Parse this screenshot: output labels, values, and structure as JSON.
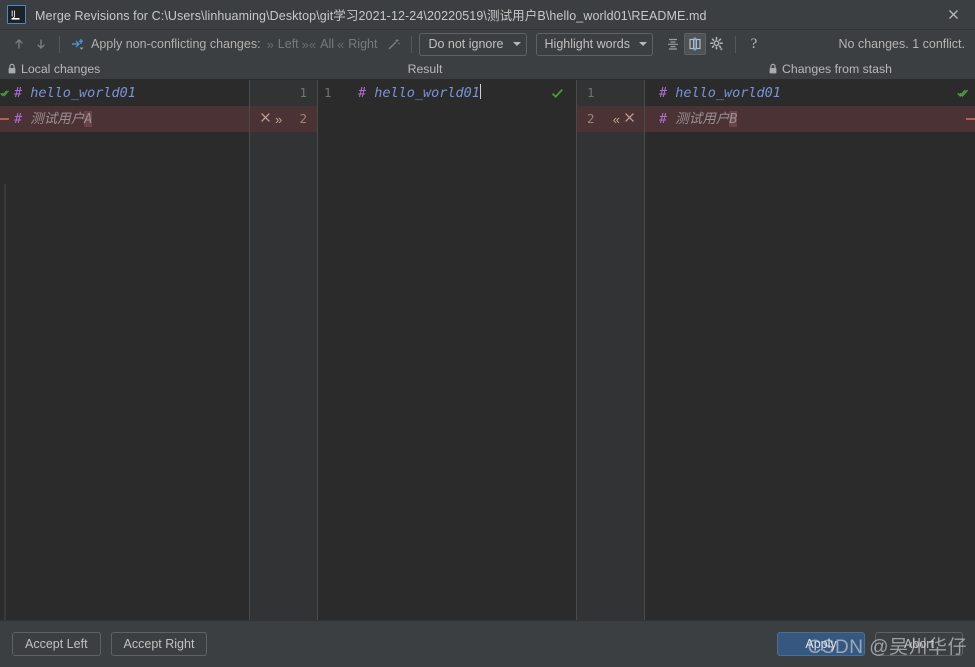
{
  "window": {
    "app_icon": "intellij-idea-icon",
    "title": "Merge Revisions for C:\\Users\\linhuaming\\Desktop\\git学习2021-12-24\\20220519\\测试用户B\\hello_world01\\README.md",
    "close_label": "✕"
  },
  "toolbar": {
    "prev_icon": "arrow-up-icon",
    "next_icon": "arrow-down-icon",
    "resolve_icon": "magic-resolve-icon",
    "apply_label": "Apply non-conflicting changes:",
    "apply_left_label": "Left",
    "apply_all_label": "All",
    "apply_right_label": "Right",
    "wand_icon": "magic-wand-icon",
    "ignore_policy": "Do not ignore",
    "highlight_policy": "Highlight words",
    "collapse_icon": "collapse-unchanged-icon",
    "whitespace_icon": "show-whitespace-icon",
    "settings_icon": "gear-icon",
    "help_icon": "help-icon",
    "status": "No changes. 1 conflict."
  },
  "headers": {
    "left": "Local changes",
    "middle": "Result",
    "right": "Changes from stash",
    "lock_icon": "lock-icon"
  },
  "diff": {
    "left_pane": {
      "name": "Local changes",
      "lines": [
        {
          "marker": "accepted-check",
          "hash": "#",
          "text": " hello_world01",
          "conflict": false
        },
        {
          "marker": "deleted-dash",
          "hash": "#",
          "text": " 测试用户",
          "tail": "A",
          "conflict": true
        }
      ]
    },
    "result_pane": {
      "name": "Result",
      "lines": [
        {
          "hash": "#",
          "text": " hello_world01",
          "status_icon": "check-icon",
          "conflict": false
        },
        {
          "hash": "",
          "text": "",
          "conflict": true
        }
      ]
    },
    "right_pane": {
      "name": "Changes from stash",
      "lines": [
        {
          "marker": "accepted-check",
          "hash": "#",
          "text": " hello_world01",
          "conflict": false
        },
        {
          "marker": "deleted-dash",
          "hash": "#",
          "text": " 测试用户",
          "tail": "B",
          "conflict": true
        }
      ]
    },
    "left_gutter": {
      "numbers": [
        "1",
        "2"
      ],
      "conflict_actions": [
        "revert-icon",
        "accept-right-icon"
      ]
    },
    "result_gutter_left_numbers": [
      "1"
    ],
    "result_gutter_right_numbers": [
      "1"
    ],
    "right_gutter": {
      "numbers": [
        "1",
        "2"
      ],
      "conflict_actions": [
        "accept-left-icon",
        "revert-icon"
      ]
    }
  },
  "footer": {
    "accept_left": "Accept Left",
    "accept_right": "Accept Right",
    "apply": "Apply",
    "abort": "Abort"
  },
  "watermark": {
    "text": "CSDN @吴州华仔"
  },
  "colors": {
    "background": "#3c3f41",
    "editor_bg": "#2b2b2b",
    "gutter_bg": "#313335",
    "conflict_bg": "#4b3234",
    "accent_blue": "#365880",
    "check_green": "#4e9a3f",
    "keyword_purple": "#b06ad4",
    "string_blue": "#7a93d6",
    "delete_red": "#b3604f"
  }
}
